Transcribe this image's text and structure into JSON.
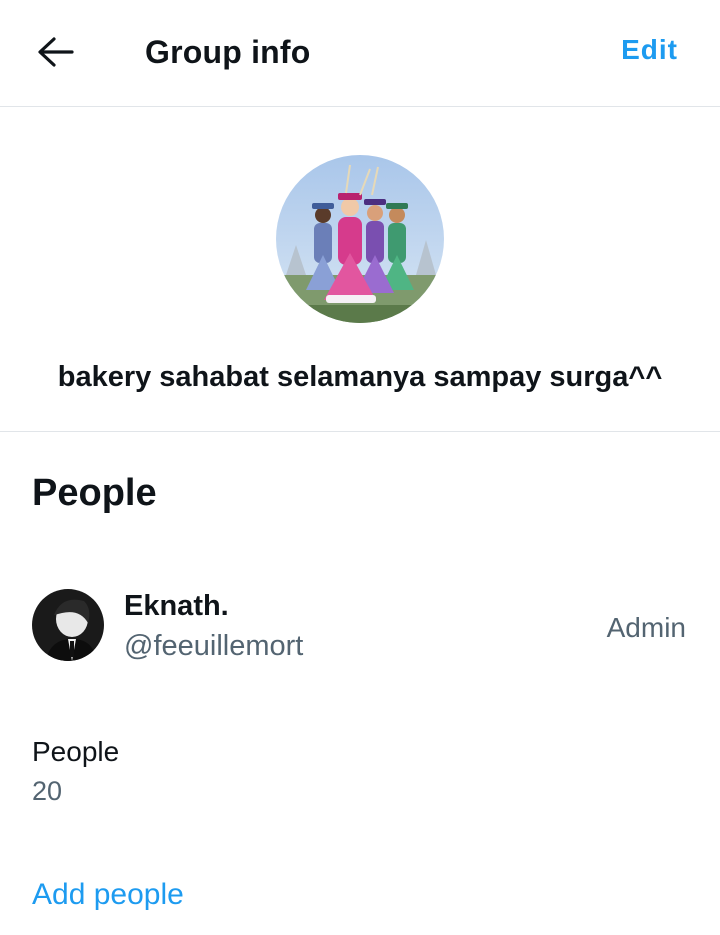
{
  "header": {
    "title": "Group info",
    "edit_label": "Edit",
    "back_icon": "arrow-left-icon"
  },
  "group": {
    "name": "bakery sahabat selamanya sampay surga^^",
    "avatar_icon": "group-photo"
  },
  "people_section": {
    "heading": "People",
    "members": [
      {
        "display_name": "Eknath.",
        "handle": "@feeuillemort",
        "role": "Admin"
      }
    ],
    "count_label": "People",
    "count_value": "20",
    "add_label": "Add people"
  },
  "colors": {
    "accent": "#1d9bf0",
    "text_primary": "#0f1419",
    "text_secondary": "#536471",
    "divider": "#e1e5e9"
  }
}
